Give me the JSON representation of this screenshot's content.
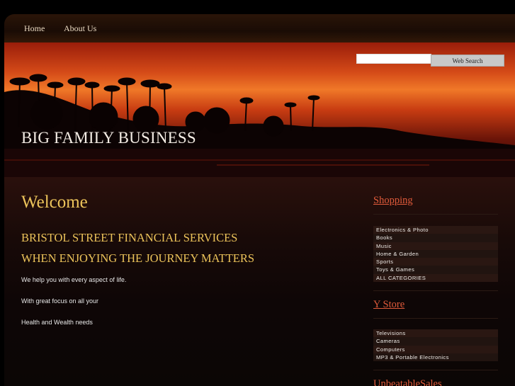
{
  "nav": {
    "items": [
      "Home",
      "About Us"
    ]
  },
  "header": {
    "site_title": "BIG FAMILY BUSINESS"
  },
  "search": {
    "value": "",
    "button_label": "Web Search"
  },
  "main": {
    "welcome": "Welcome",
    "heading1": "BRISTOL STREET FINANCIAL SERVICES",
    "heading2": "WHEN ENJOYING THE JOURNEY MATTERS",
    "paragraphs": [
      "We help you with every aspect of life.",
      "With great focus on all your",
      "Health and Wealth needs"
    ]
  },
  "sidebar": {
    "shopping": {
      "title": "Shopping",
      "items": [
        "Electronics & Photo",
        "Books",
        "Music",
        "Home & Garden",
        "Sports",
        "Toys & Games",
        "ALL CATEGORIES"
      ]
    },
    "ystore": {
      "title": "Y Store",
      "items": [
        "Televisions",
        "Cameras",
        "Computers",
        "MP3 & Portable Electronics"
      ]
    },
    "unbeatable": {
      "title": "UnbeatableSales"
    }
  },
  "colors": {
    "accent_gold": "#ecc35a",
    "link_red": "#e05a3a",
    "nav_text": "#e9d8c0"
  }
}
